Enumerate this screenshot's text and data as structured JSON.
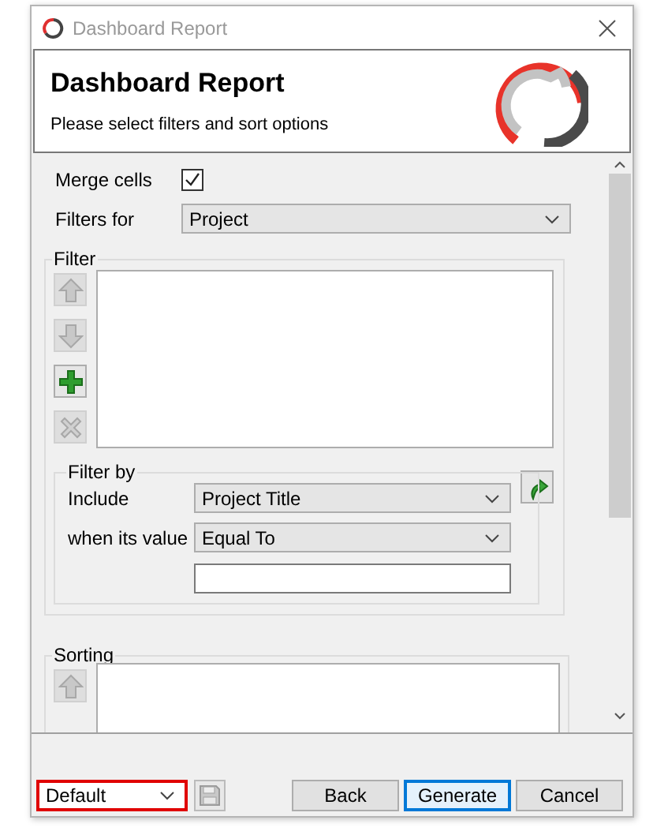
{
  "window": {
    "title": "Dashboard Report"
  },
  "header": {
    "title": "Dashboard Report",
    "subtitle": "Please select filters and sort options"
  },
  "merge_cells": {
    "label": "Merge cells",
    "checked": true
  },
  "filters_for": {
    "label": "Filters for",
    "value": "Project"
  },
  "filter": {
    "legend": "Filter",
    "buttons": [
      {
        "kind": "up",
        "disabled": true
      },
      {
        "kind": "down",
        "disabled": true
      },
      {
        "kind": "add",
        "disabled": false
      },
      {
        "kind": "remove",
        "disabled": true
      }
    ]
  },
  "filter_by": {
    "legend": "Filter by",
    "include": {
      "label": "Include",
      "value": "Project Title"
    },
    "condition": {
      "label": "when its value",
      "value": "Equal To"
    }
  },
  "sorting": {
    "legend": "Sorting",
    "buttons": [
      {
        "kind": "up",
        "disabled": true
      }
    ]
  },
  "footer": {
    "preset": "Default",
    "buttons": [
      {
        "label": "Back",
        "selected": false
      },
      {
        "label": "Generate",
        "selected": true
      },
      {
        "label": "Cancel",
        "selected": false
      }
    ]
  }
}
